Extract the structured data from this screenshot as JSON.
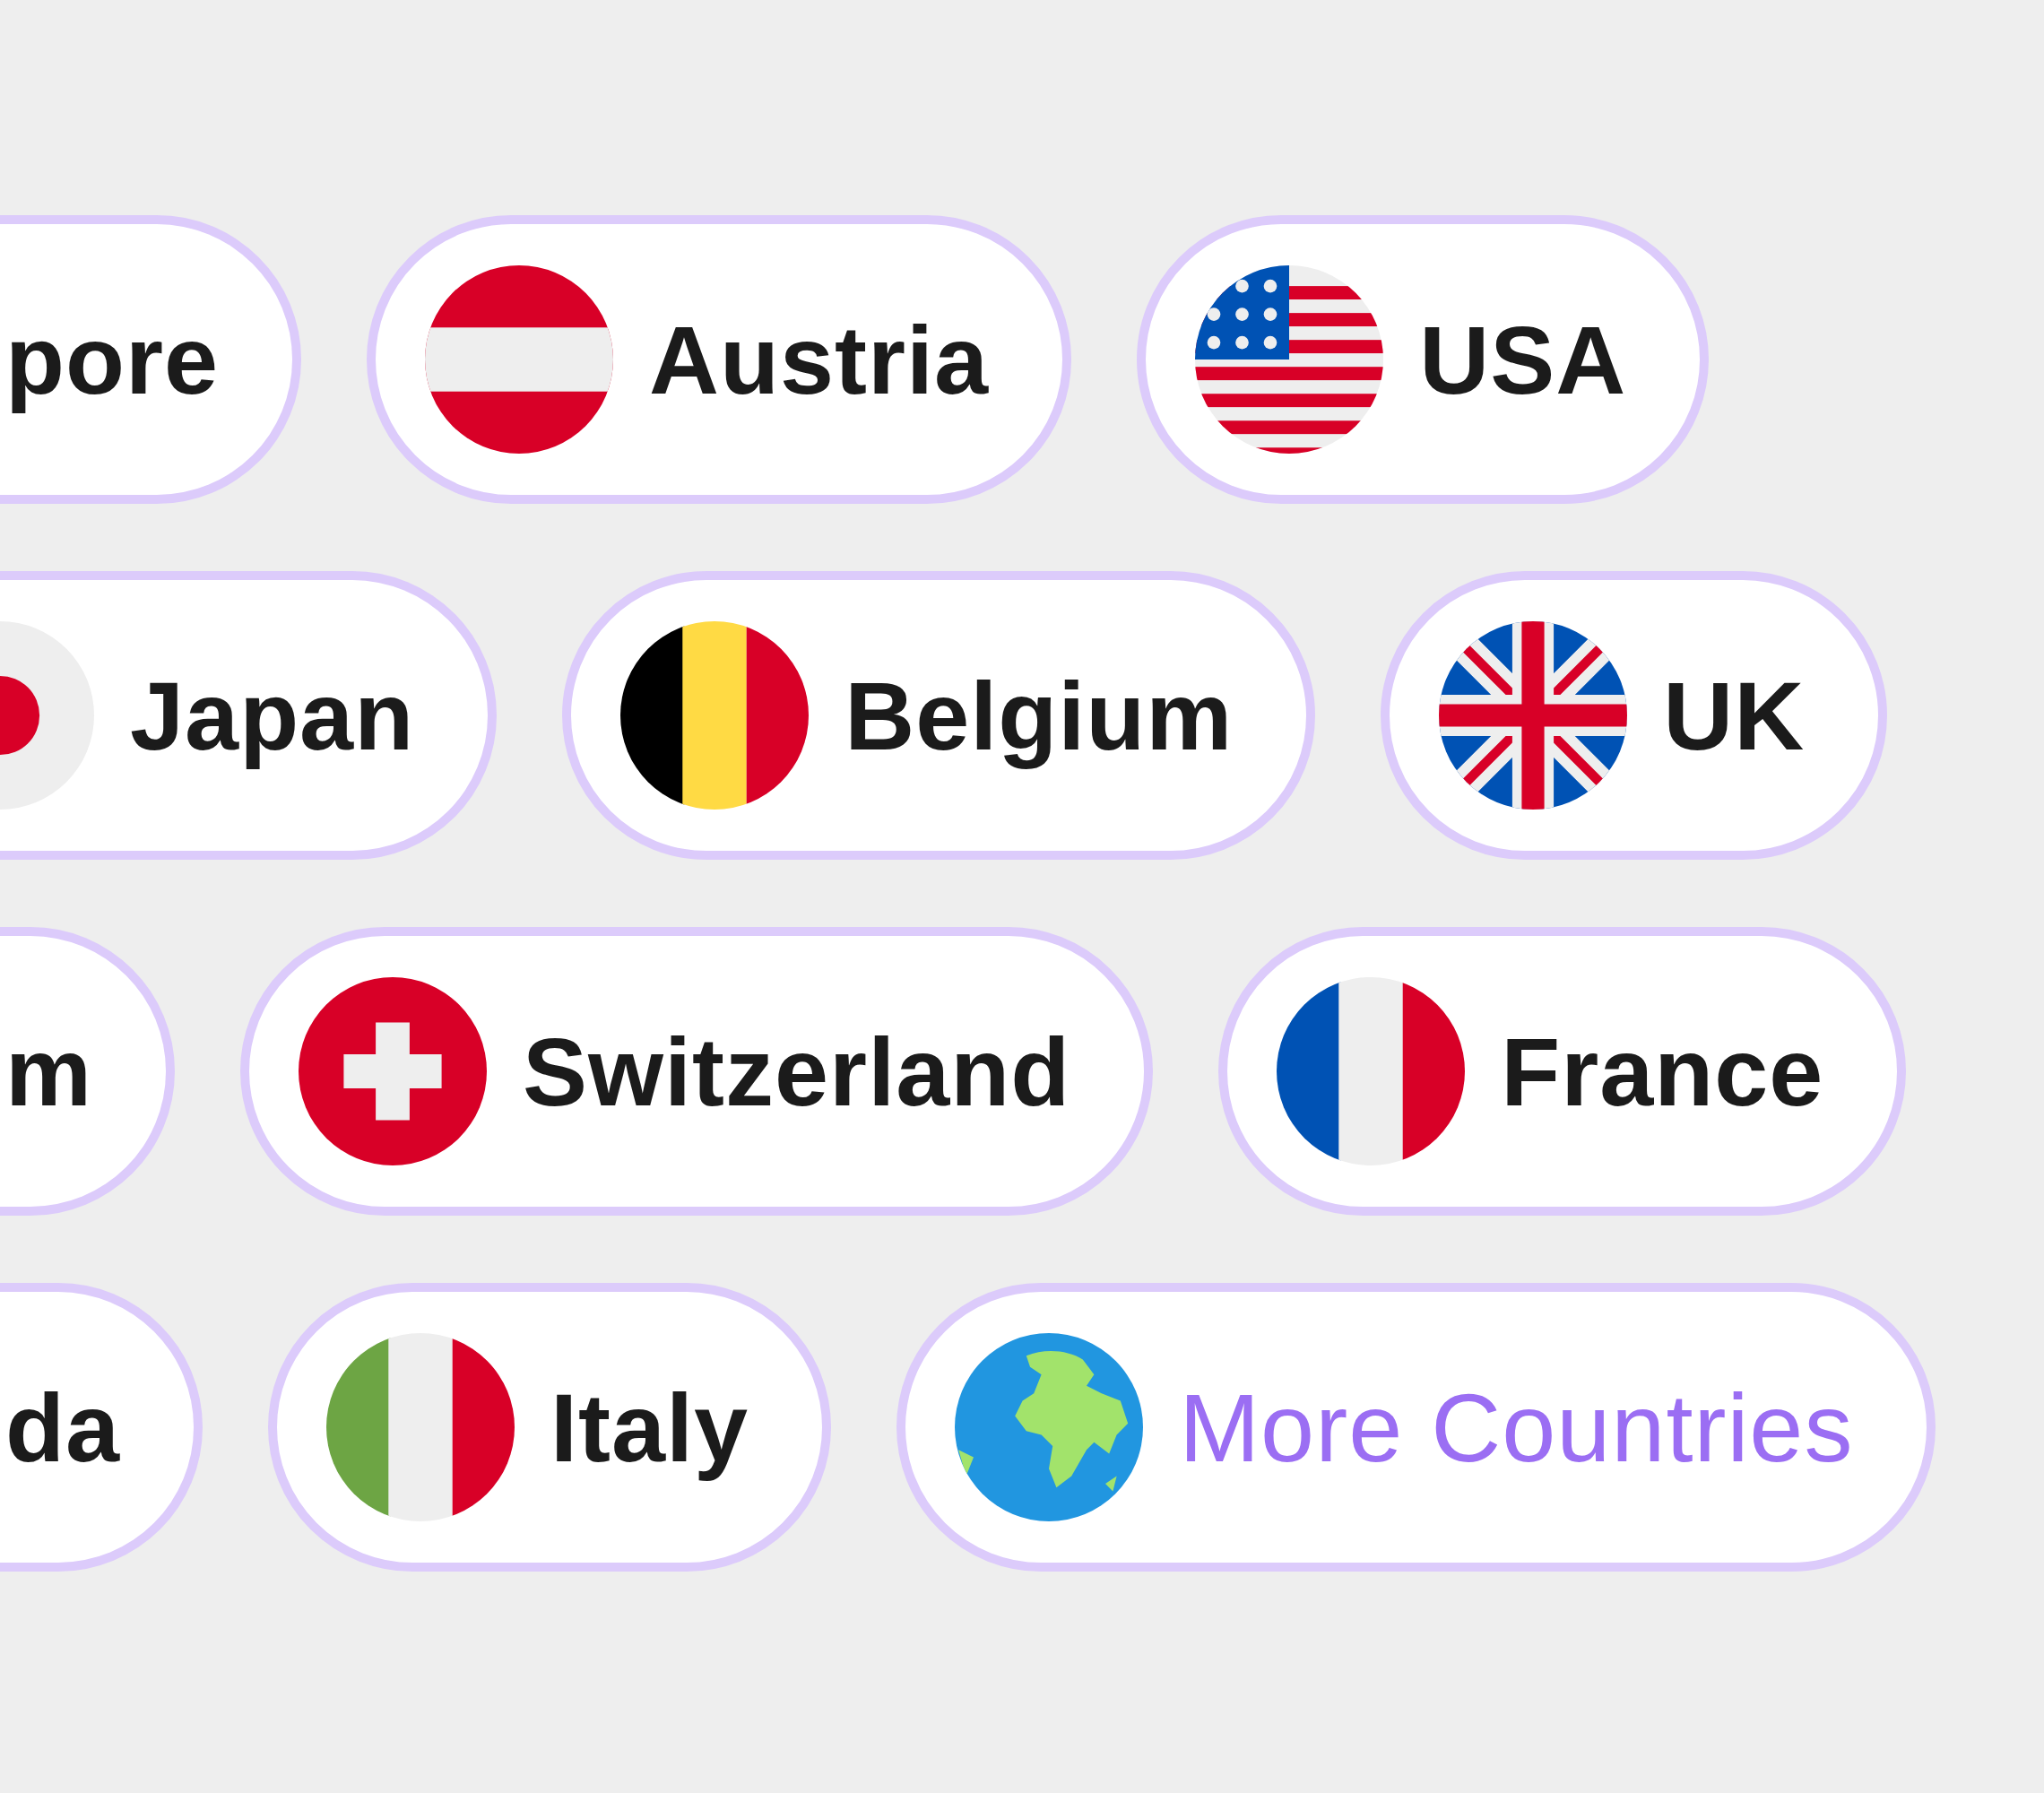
{
  "rows": [
    {
      "chips": [
        {
          "kind": "country",
          "label": "pore",
          "partial": true
        },
        {
          "kind": "country",
          "label": "Austria",
          "flag": {
            "kind": "austria"
          },
          "partial": false
        },
        {
          "kind": "country",
          "label": "USA",
          "flag": {
            "kind": "usa"
          },
          "partial": false
        }
      ]
    },
    {
      "chips": [
        {
          "kind": "country",
          "label": "Japan",
          "flag": {
            "kind": "japan"
          },
          "partial": true
        },
        {
          "kind": "country",
          "label": "Belgium",
          "flag": {
            "kind": "belgium"
          },
          "partial": false
        },
        {
          "kind": "country",
          "label": "UK",
          "flag": {
            "kind": "uk"
          },
          "partial": false
        }
      ]
    },
    {
      "chips": [
        {
          "kind": "country",
          "label": "m",
          "partial": true
        },
        {
          "kind": "country",
          "label": "Switzerland",
          "flag": {
            "kind": "switzerland"
          },
          "partial": false
        },
        {
          "kind": "country",
          "label": "France",
          "flag": {
            "kind": "france"
          },
          "partial": false
        }
      ]
    },
    {
      "chips": [
        {
          "kind": "country",
          "label": "da",
          "partial": true
        },
        {
          "kind": "country",
          "label": "Italy",
          "flag": {
            "kind": "italy"
          },
          "partial": false
        },
        {
          "kind": "more",
          "label": "More Countries",
          "flag": {
            "kind": "globe"
          },
          "partial": false
        }
      ]
    }
  ]
}
